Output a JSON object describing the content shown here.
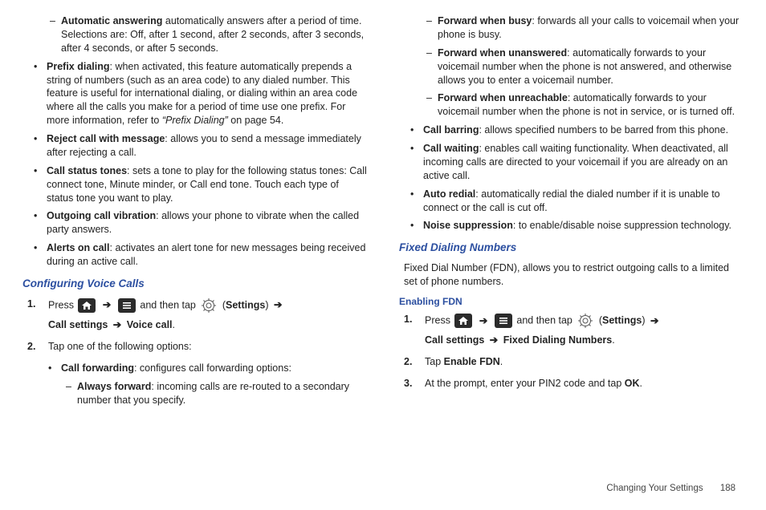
{
  "left": {
    "auto_answer_bold": "Automatic answering",
    "auto_answer_rest": " automatically answers after a period of time. Selections are: Off, after 1 second, after 2 seconds, after 3 seconds, after 4 seconds, or after 5 seconds.",
    "prefix_bold": "Prefix dialing",
    "prefix_rest_a": ": when activated, this feature automatically prepends a string of numbers (such as an area code) to any dialed number. This feature is useful for international dialing, or dialing within an area code where all the calls you make for a period of time use one prefix. For more information, refer to ",
    "prefix_ref": "“Prefix Dialing”",
    "prefix_rest_b": "  on page 54.",
    "reject_bold": "Reject call with message",
    "reject_rest": ": allows you to send a message immediately after rejecting a call.",
    "status_bold": "Call status tones",
    "status_rest": ": sets a tone to play for the following status tones: Call connect tone, Minute minder, or Call end tone. Touch each type of status tone you want to play.",
    "outgoing_bold": "Outgoing call vibration",
    "outgoing_rest": ": allows your phone to vibrate when the called party answers.",
    "alerts_bold": "Alerts on call",
    "alerts_rest": ": activates an alert tone for new messages being received during an active call.",
    "config_heading": "Configuring Voice Calls",
    "step1_press": "Press ",
    "step1_andtap": " and then tap ",
    "step1_settings": "Settings",
    "step1_line2_a": "Call settings ",
    "step1_line2_b": " Voice call",
    "step2": "Tap one of the following options:",
    "callfwd_bold": "Call forwarding",
    "callfwd_rest": ": configures call forwarding options:",
    "always_bold": "Always forward",
    "always_rest": ": incoming calls are re-routed to a secondary number that you specify."
  },
  "right": {
    "fwd_busy_bold": "Forward when busy",
    "fwd_busy_rest": ": forwards all your calls to voicemail when your phone is busy.",
    "fwd_unans_bold": "Forward when unanswered",
    "fwd_unans_rest": ": automatically forwards to your voicemail number when the phone is not answered, and otherwise allows you to enter a voicemail number.",
    "fwd_unreach_bold": "Forward when unreachable",
    "fwd_unreach_rest": ": automatically forwards to your voicemail number when the phone is not in service, or is turned off.",
    "barring_bold": "Call barring",
    "barring_rest": ": allows specified numbers to be barred from this phone.",
    "waiting_bold": "Call waiting",
    "waiting_rest": ": enables call waiting functionality. When deactivated, all incoming calls are directed to your voicemail if you are already on an active call.",
    "redial_bold": "Auto redial",
    "redial_rest": ": automatically redial the dialed number if it is unable to connect or the call is cut off.",
    "noise_bold": "Noise suppression",
    "noise_rest": ": to enable/disable noise suppression technology.",
    "fdn_heading": "Fixed Dialing Numbers",
    "fdn_body": "Fixed Dial Number (FDN), allows you to restrict outgoing calls to a limited set of phone numbers.",
    "enable_heading": "Enabling FDN",
    "step1_press": "Press ",
    "step1_andtap": " and then tap ",
    "step1_settings": "Settings",
    "step1_line2_a": "Call settings ",
    "step1_line2_b": " Fixed Dialing Numbers",
    "step2_a": "Tap ",
    "step2_b": "Enable FDN",
    "step3_a": "At the prompt, enter your PIN2 code and tap ",
    "step3_b": "OK"
  },
  "footer": {
    "section": "Changing Your Settings",
    "page": "188"
  },
  "glyph": {
    "dash": "–",
    "bullet": "•",
    "arrow": "➔",
    "n1": "1.",
    "n2": "2.",
    "n3": "3.",
    "dot": "."
  }
}
